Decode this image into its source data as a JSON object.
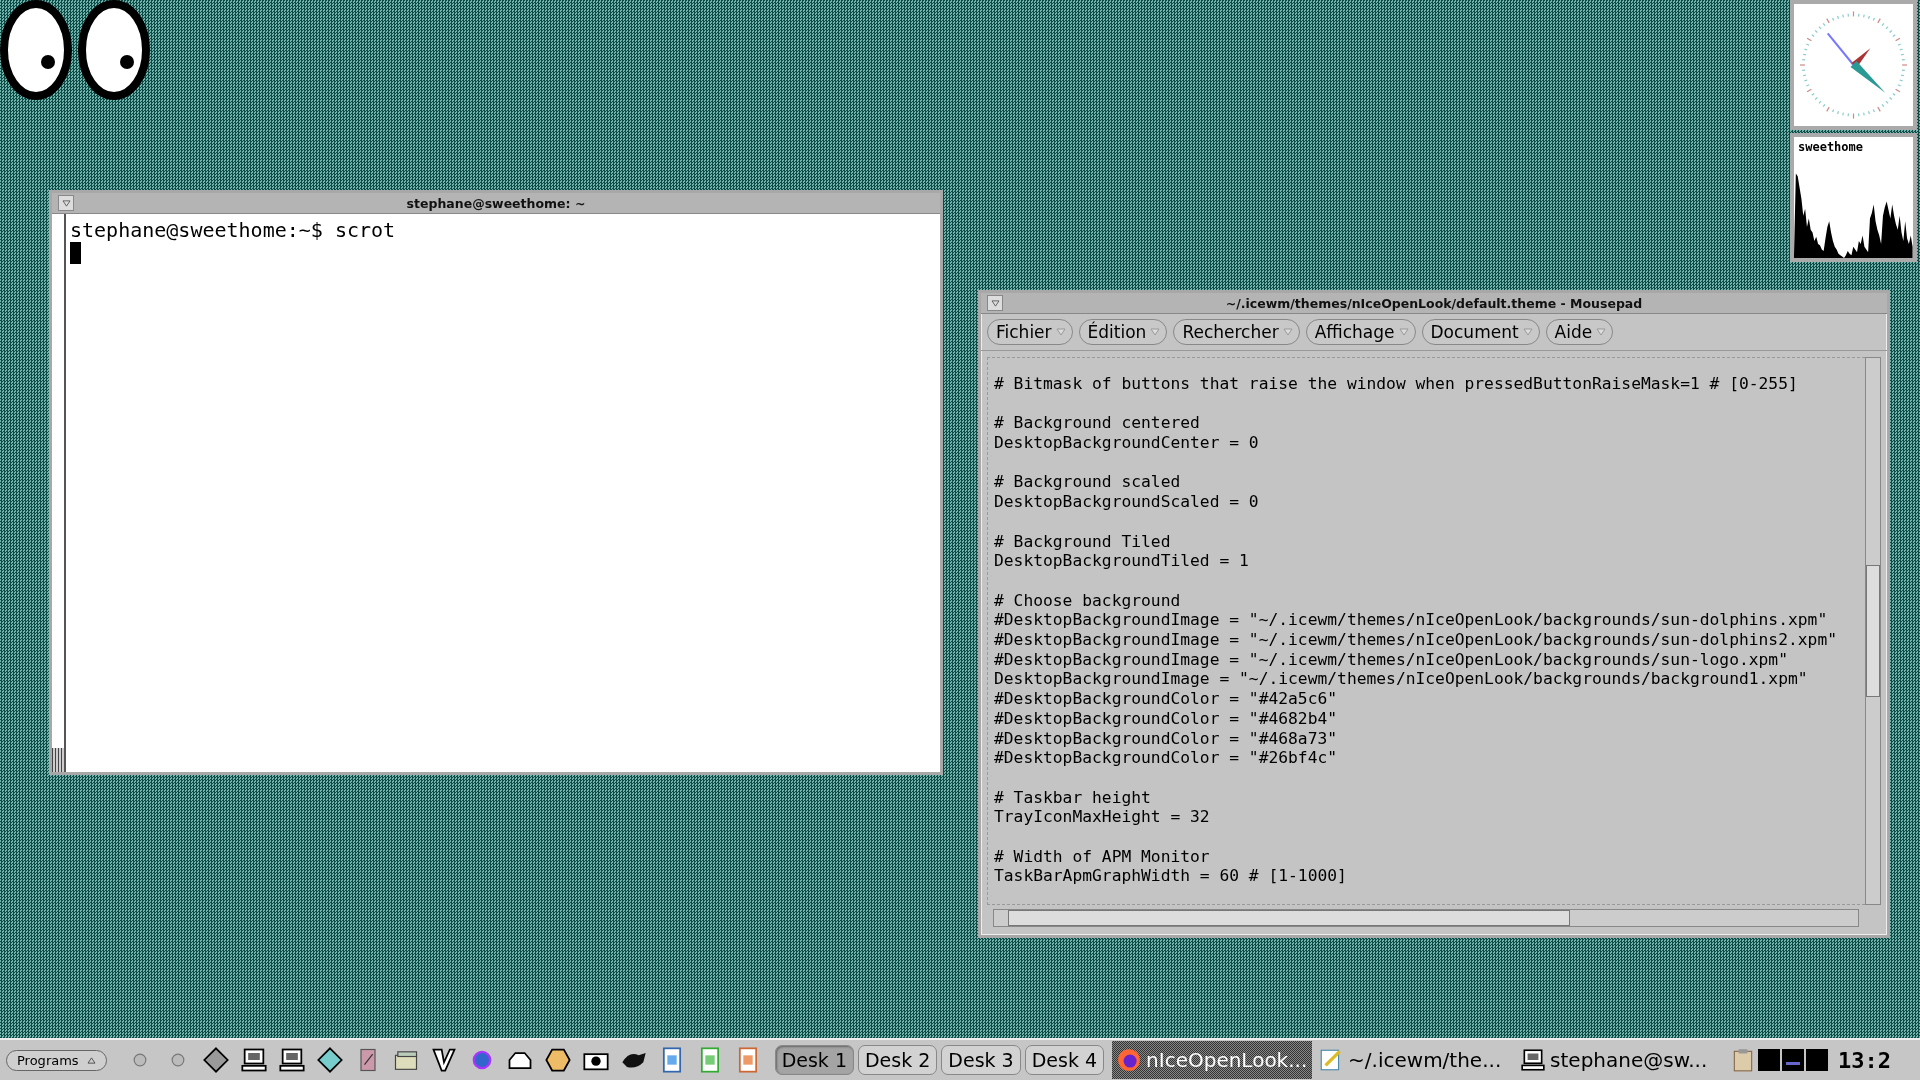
{
  "load_monitor": {
    "host": "sweethome"
  },
  "terminal": {
    "title": "stephane@sweethome: ~",
    "lines": [
      "stephane@sweethome:~$ scrot"
    ],
    "cursor_visible": true
  },
  "editor": {
    "title": "~/.icewm/themes/nIceOpenLook/default.theme - Mousepad",
    "menus": [
      "Fichier",
      "Édition",
      "Rechercher",
      "Affichage",
      "Document",
      "Aide"
    ],
    "paragraphs": [
      [
        "# Bitmask of buttons that raise the window when pressedButtonRaiseMask=1 # [0-255]"
      ],
      [
        "# Background centered",
        "DesktopBackgroundCenter = 0"
      ],
      [
        "# Background scaled",
        "DesktopBackgroundScaled = 0"
      ],
      [
        "# Background Tiled",
        "DesktopBackgroundTiled = 1"
      ],
      [
        "# Choose background",
        "#DesktopBackgroundImage = \"~/.icewm/themes/nIceOpenLook/backgrounds/sun-dolphins.xpm\"",
        "#DesktopBackgroundImage = \"~/.icewm/themes/nIceOpenLook/backgrounds/sun-dolphins2.xpm\"",
        "#DesktopBackgroundImage = \"~/.icewm/themes/nIceOpenLook/backgrounds/sun-logo.xpm\"",
        "DesktopBackgroundImage = \"~/.icewm/themes/nIceOpenLook/backgrounds/background1.xpm\"",
        "#DesktopBackgroundColor = \"#42a5c6\"",
        "#DesktopBackgroundColor = \"#4682b4\"",
        "#DesktopBackgroundColor = \"#468a73\"",
        "#DesktopBackgroundColor = \"#26bf4c\""
      ],
      [
        "# Taskbar height",
        "TrayIconMaxHeight = 32"
      ],
      [
        "# Width of APM Monitor",
        "TaskBarApmGraphWidth = 60 # [1-1000]"
      ]
    ]
  },
  "taskbar": {
    "start_label": "Programs",
    "desks": [
      {
        "label": "Desk 1",
        "selected": true
      },
      {
        "label": "Desk 2",
        "selected": false
      },
      {
        "label": "Desk 3",
        "selected": false
      },
      {
        "label": "Desk 4",
        "selected": false
      }
    ],
    "tasks": [
      {
        "kind": "browser",
        "label": "nIceOpenLook...",
        "selected": true
      },
      {
        "kind": "editor",
        "label": "~/.icewm/the...",
        "selected": false
      },
      {
        "kind": "terminal",
        "label": "stephane@sw...",
        "selected": false
      }
    ],
    "clock": "13:2"
  }
}
